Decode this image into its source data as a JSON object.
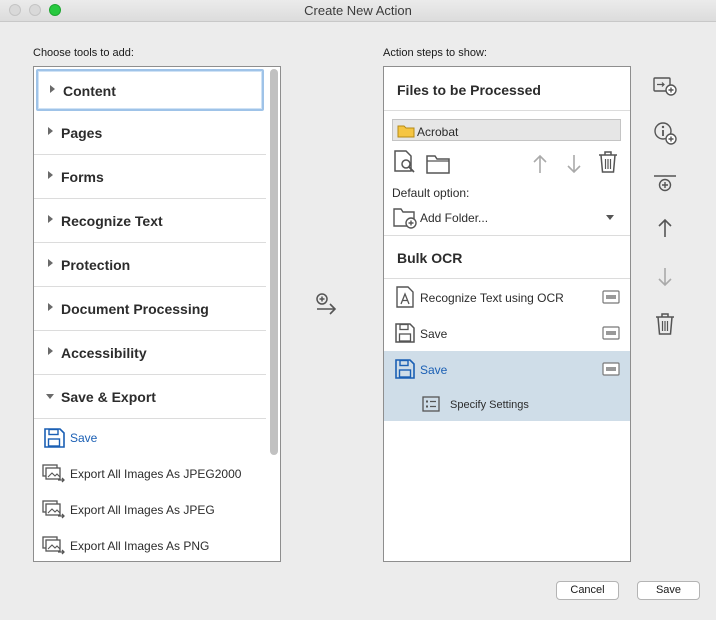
{
  "window": {
    "title": "Create New Action"
  },
  "left": {
    "heading": "Choose tools to add:",
    "categories": [
      {
        "label": "Content"
      },
      {
        "label": "Pages"
      },
      {
        "label": "Forms"
      },
      {
        "label": "Recognize Text"
      },
      {
        "label": "Protection"
      },
      {
        "label": "Document Processing"
      },
      {
        "label": "Accessibility"
      },
      {
        "label": "Save & Export"
      }
    ],
    "tools": [
      {
        "label": "Save",
        "icon": "save-icon"
      },
      {
        "label": "Export All Images As JPEG2000",
        "icon": "export-images-icon"
      },
      {
        "label": "Export All Images As JPEG",
        "icon": "export-images-icon"
      },
      {
        "label": "Export All Images As PNG",
        "icon": "export-images-icon"
      }
    ]
  },
  "right": {
    "heading": "Action steps to show:",
    "files_group": {
      "title": "Files to be Processed",
      "folder": "Acrobat",
      "default_option_label": "Default option:",
      "default_option_value": "Add Folder..."
    },
    "ocr_group": {
      "title": "Bulk OCR",
      "steps": [
        {
          "label": "Recognize Text using OCR",
          "icon": "ocr-icon"
        },
        {
          "label": "Save",
          "icon": "save-icon"
        },
        {
          "label": "Save",
          "icon": "save-icon",
          "selected": true
        }
      ],
      "sub_step": "Specify Settings"
    }
  },
  "buttons": {
    "cancel": "Cancel",
    "save": "Save"
  },
  "colors": {
    "selection": "#cfdde8",
    "link_blue": "#1a5fb4",
    "zoom_green": "#27c93f"
  }
}
